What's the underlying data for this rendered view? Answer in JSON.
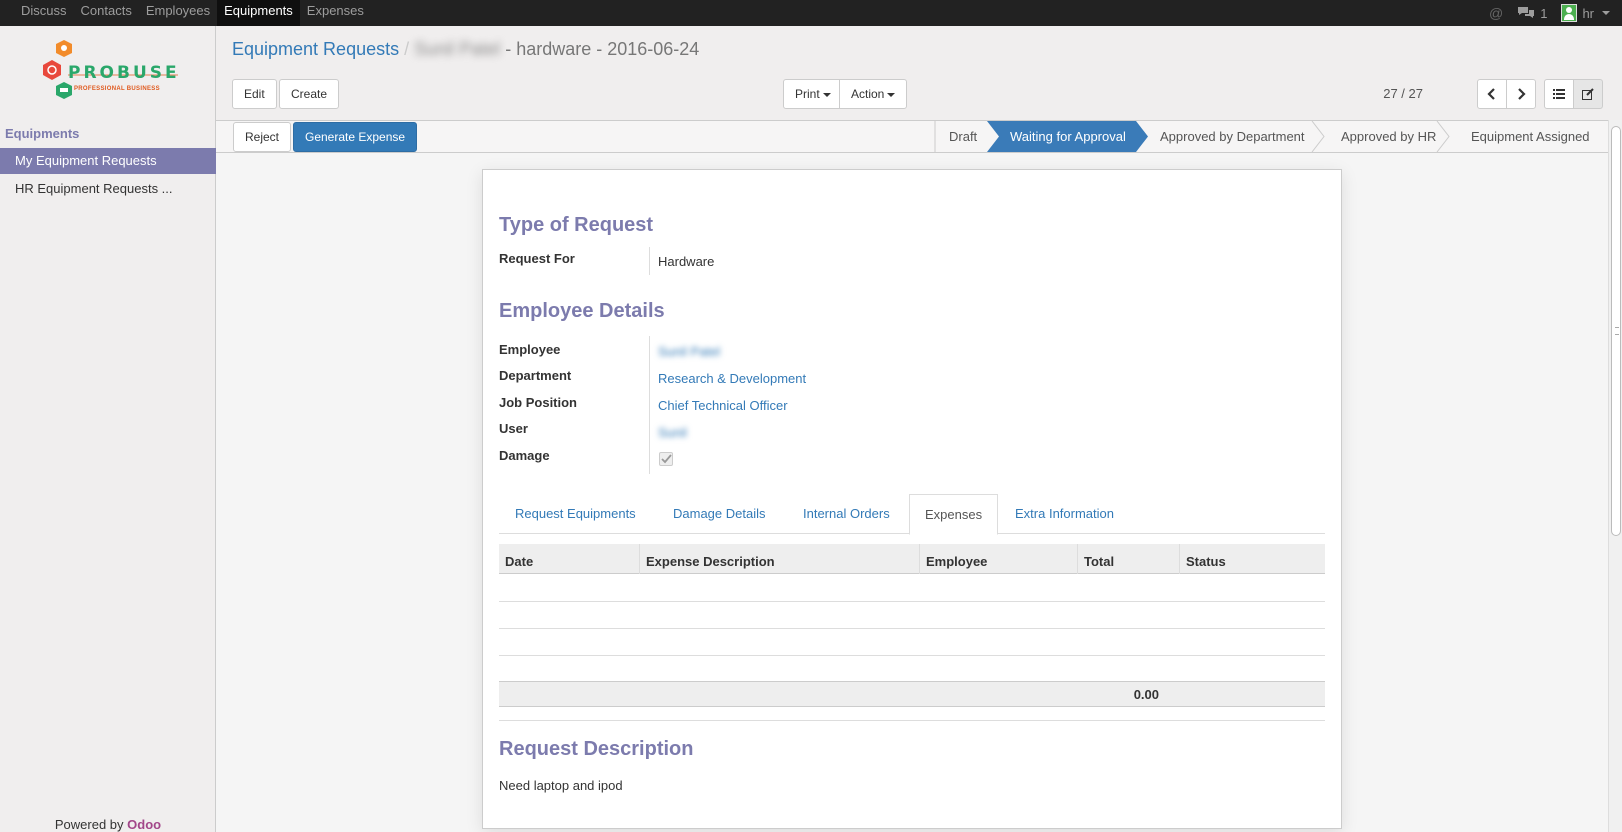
{
  "topbar": {
    "menu": [
      "Discuss",
      "Contacts",
      "Employees",
      "Equipments",
      "Expenses"
    ],
    "active_menu": "Equipments",
    "message_count": "1",
    "user": "hr"
  },
  "sidebar": {
    "logo_word": "PROBUSE",
    "logo_sub": "PROFESSIONAL BUSINESS",
    "section_title": "Equipments",
    "items": [
      {
        "label": "My Equipment Requests"
      },
      {
        "label": "HR Equipment Requests ..."
      }
    ],
    "powered_prefix": "Powered by",
    "powered_brand": "Odoo"
  },
  "control_panel": {
    "breadcrumb_root": "Equipment Requests",
    "breadcrumb_sep": "/",
    "breadcrumb_blurred": "Sunil Patel",
    "breadcrumb_current": "- hardware - 2016-06-24",
    "buttons": {
      "edit": "Edit",
      "create": "Create",
      "print": "Print",
      "action": "Action"
    },
    "pager": "27 / 27"
  },
  "statusbar": {
    "buttons": {
      "reject": "Reject",
      "generate_expense": "Generate Expense"
    },
    "stages": [
      "Draft",
      "Waiting for Approval",
      "Approved by Department",
      "Approved by HR",
      "Equipment Assigned"
    ],
    "active_stage": "Waiting for Approval"
  },
  "form": {
    "type_section": "Type of Request",
    "request_for_label": "Request For",
    "request_for_value": "Hardware",
    "employee_section": "Employee Details",
    "fields": [
      {
        "label": "Employee",
        "value": "Sunil Patel"
      },
      {
        "label": "Department",
        "value": "Research & Development"
      },
      {
        "label": "Job Position",
        "value": "Chief Technical Officer"
      },
      {
        "label": "User",
        "value": "Sunil"
      },
      {
        "label": "Damage",
        "value": "checked"
      }
    ],
    "tabs": [
      "Request Equipments",
      "Damage Details",
      "Internal Orders",
      "Expenses",
      "Extra Information"
    ],
    "active_tab": "Expenses",
    "table": {
      "headers": [
        "Date",
        "Expense Description",
        "Employee",
        "Total",
        "Status"
      ],
      "rows": [],
      "total": "0.00"
    },
    "description_section": "Request Description",
    "description": "Need laptop and ipod"
  },
  "colors": {
    "accent": "#7c7bad",
    "primary": "#337ab7",
    "topbar": "#222222",
    "odoo": "#a24689"
  }
}
